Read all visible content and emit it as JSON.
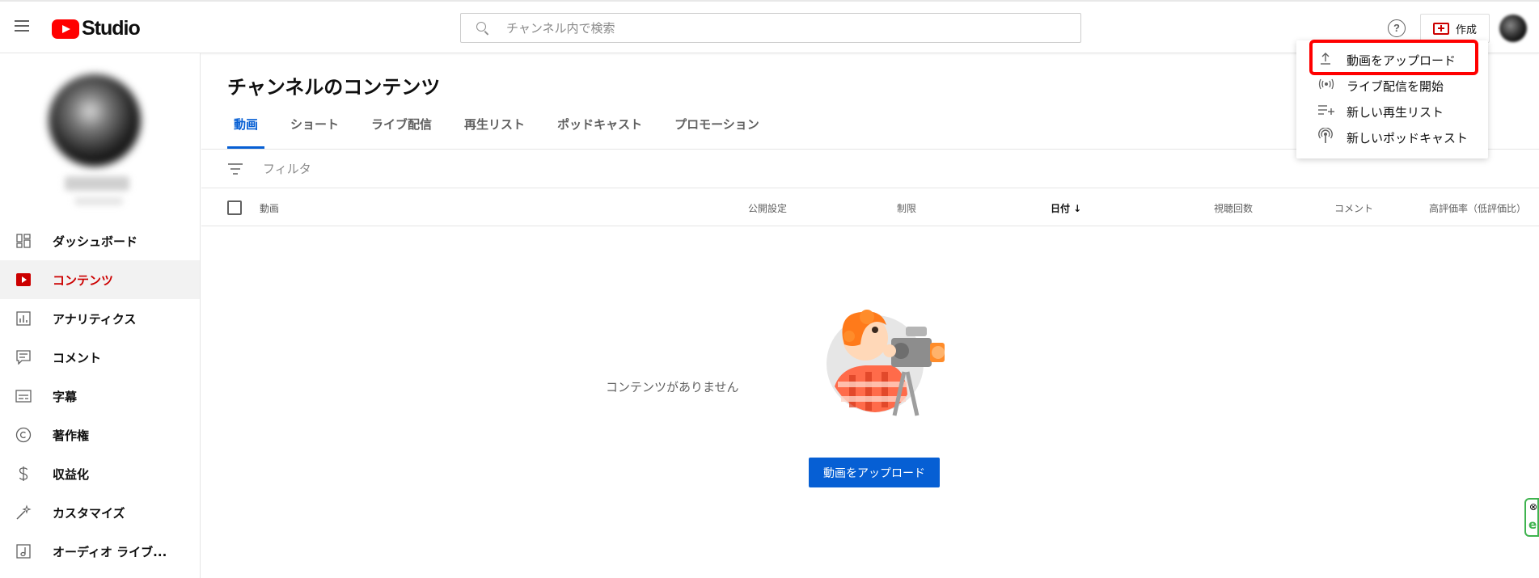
{
  "app": {
    "logo_text": "Studio"
  },
  "search": {
    "placeholder": "チャンネル内で検索"
  },
  "header": {
    "help_symbol": "?",
    "create_label": "作成"
  },
  "sidebar": {
    "items": [
      {
        "label": "ダッシュボード",
        "icon": "dashboard-icon",
        "active": false
      },
      {
        "label": "コンテンツ",
        "icon": "content-icon",
        "active": true
      },
      {
        "label": "アナリティクス",
        "icon": "analytics-icon",
        "active": false
      },
      {
        "label": "コメント",
        "icon": "comment-icon",
        "active": false
      },
      {
        "label": "字幕",
        "icon": "subtitles-icon",
        "active": false
      },
      {
        "label": "著作権",
        "icon": "copyright-icon",
        "active": false
      },
      {
        "label": "収益化",
        "icon": "dollar-icon",
        "active": false
      },
      {
        "label": "カスタマイズ",
        "icon": "wand-icon",
        "active": false
      },
      {
        "label": "オーディオ ライブ...",
        "icon": "audio-library-icon",
        "active": false
      }
    ]
  },
  "main": {
    "title": "チャンネルのコンテンツ",
    "tabs": [
      {
        "label": "動画",
        "active": true
      },
      {
        "label": "ショート",
        "active": false
      },
      {
        "label": "ライブ配信",
        "active": false
      },
      {
        "label": "再生リスト",
        "active": false
      },
      {
        "label": "ポッドキャスト",
        "active": false
      },
      {
        "label": "プロモーション",
        "active": false
      }
    ],
    "filter_placeholder": "フィルタ",
    "columns": {
      "video": "動画",
      "visibility": "公開設定",
      "restrictions": "制限",
      "date": "日付 ↓",
      "views": "視聴回数",
      "comments": "コメント",
      "likes": "高評価率（低評価比）"
    },
    "empty_text": "コンテンツがありません",
    "upload_button": "動画をアップロード"
  },
  "create_menu": {
    "items": [
      {
        "label": "動画をアップロード",
        "icon": "upload-icon",
        "glyph": "⤒"
      },
      {
        "label": "ライブ配信を開始",
        "icon": "live-icon",
        "glyph": "((•))"
      },
      {
        "label": "新しい再生リスト",
        "icon": "playlist-add-icon",
        "glyph": "≡+"
      },
      {
        "label": "新しいポッドキャスト",
        "icon": "podcast-icon",
        "glyph": "◎"
      }
    ]
  },
  "colors": {
    "brand_red": "#ff0000",
    "active_red": "#cc0000",
    "link_blue": "#065fd4",
    "highlight": "#ff0000"
  }
}
